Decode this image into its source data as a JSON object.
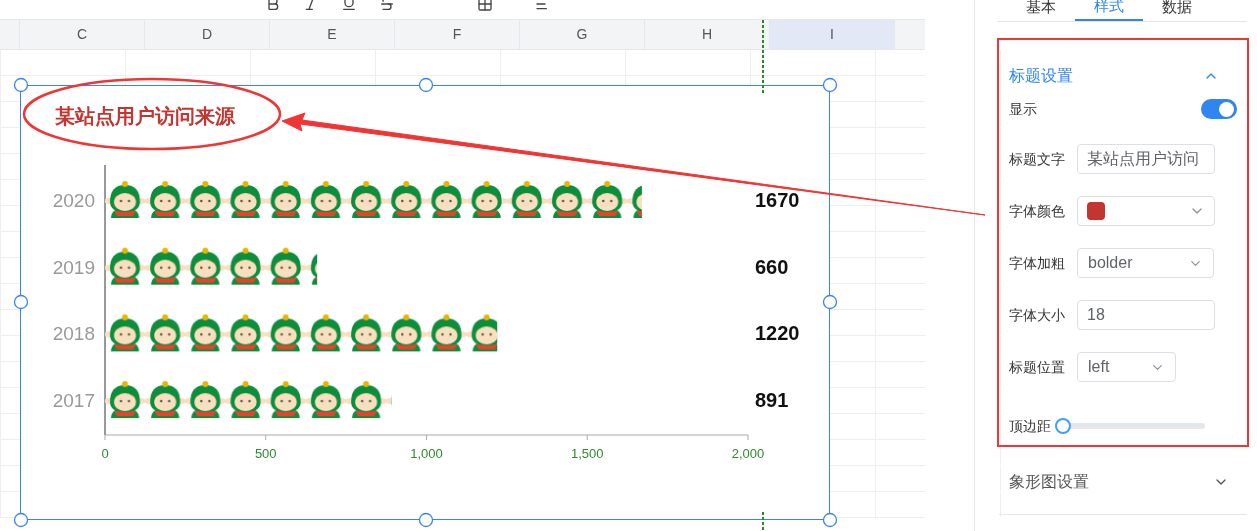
{
  "sheet": {
    "columns": [
      {
        "label": "C",
        "selected": false
      },
      {
        "label": "D",
        "selected": false
      },
      {
        "label": "E",
        "selected": false
      },
      {
        "label": "F",
        "selected": false
      },
      {
        "label": "G",
        "selected": false
      },
      {
        "label": "H",
        "selected": false
      },
      {
        "label": "I",
        "selected": true
      }
    ]
  },
  "chart": {
    "title": "某站点用户访问来源",
    "chart_data": {
      "type": "bar",
      "orientation": "horizontal",
      "categories": [
        "2020",
        "2019",
        "2018",
        "2017"
      ],
      "values": [
        1670,
        660,
        1220,
        891
      ],
      "xlim": [
        0,
        2000
      ],
      "xticks": [
        {
          "value": 0,
          "label": "0"
        },
        {
          "value": 500,
          "label": "500"
        },
        {
          "value": 1000,
          "label": "1,000"
        },
        {
          "value": 1500,
          "label": "1,500"
        },
        {
          "value": 2000,
          "label": "2,000"
        }
      ]
    },
    "value_texts": [
      "1670",
      "660",
      "1220",
      "891"
    ]
  },
  "panel": {
    "tabs": [
      {
        "label": "基本",
        "selected": false
      },
      {
        "label": "样式",
        "selected": true
      },
      {
        "label": "数据",
        "selected": false
      }
    ],
    "sections": [
      {
        "title": "标题设置",
        "expanded": true,
        "fields": [
          {
            "kind": "toggle",
            "label": "显示",
            "on": true
          },
          {
            "kind": "input",
            "label": "标题文字",
            "value": "某站点用户访问"
          },
          {
            "kind": "color",
            "label": "字体颜色",
            "color": "#c23531"
          },
          {
            "kind": "select",
            "label": "字体加粗",
            "value": "bolder"
          },
          {
            "kind": "input",
            "label": "字体大小",
            "value": "18"
          },
          {
            "kind": "select",
            "label": "标题位置",
            "value": "left"
          },
          {
            "kind": "slider",
            "label": "顶边距",
            "level": 0
          }
        ]
      },
      {
        "title": "象形图设置",
        "expanded": false
      }
    ]
  }
}
